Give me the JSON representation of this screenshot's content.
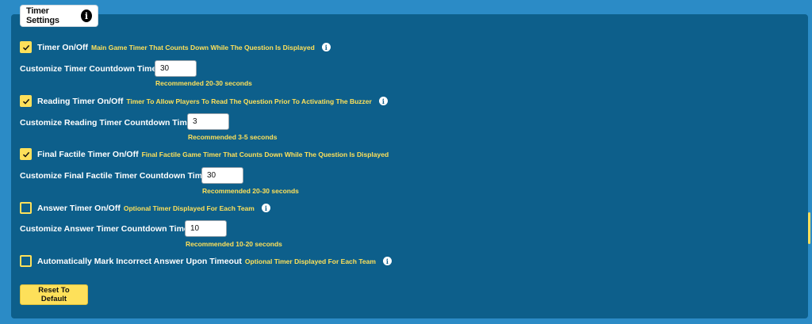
{
  "tab": {
    "label": "Timer Settings",
    "info_glyph": "i"
  },
  "options": [
    {
      "title": "Timer On/Off",
      "description": "Main Game Timer That Counts Down While The Question Is Displayed",
      "checked": true,
      "has_info": true,
      "field_label": "Customize Timer Countdown Time",
      "field_value": "30",
      "recommendation": "Recommended 20-30 seconds"
    },
    {
      "title": "Reading Timer On/Off",
      "description": "Timer To Allow Players To Read The Question Prior To Activating The Buzzer",
      "checked": true,
      "has_info": true,
      "field_label": "Customize Reading Timer Countdown Time",
      "field_value": "3",
      "recommendation": "Recommended 3-5 seconds"
    },
    {
      "title": "Final Factile Timer On/Off",
      "description": "Final Factile Game Timer That Counts Down While The Question Is Displayed",
      "checked": true,
      "has_info": false,
      "field_label": "Customize Final Factile Timer Countdown Time",
      "field_value": "30",
      "recommendation": "Recommended 20-30 seconds"
    },
    {
      "title": "Answer Timer On/Off",
      "description": "Optional Timer Displayed For Each Team",
      "checked": false,
      "has_info": true,
      "field_label": "Customize Answer Timer Countdown Time",
      "field_value": "10",
      "recommendation": "Recommended 10-20 seconds"
    },
    {
      "title": "Automatically Mark Incorrect Answer Upon Timeout",
      "description": "Optional Timer Displayed For Each Team",
      "checked": false,
      "has_info": true
    }
  ],
  "reset_label": "Reset To Default",
  "colors": {
    "panel": "#0d5f8b",
    "page": "#2b8bc6",
    "accent": "#fde05a"
  },
  "icons": {
    "checkbox": "check-icon",
    "info": "info-icon"
  }
}
